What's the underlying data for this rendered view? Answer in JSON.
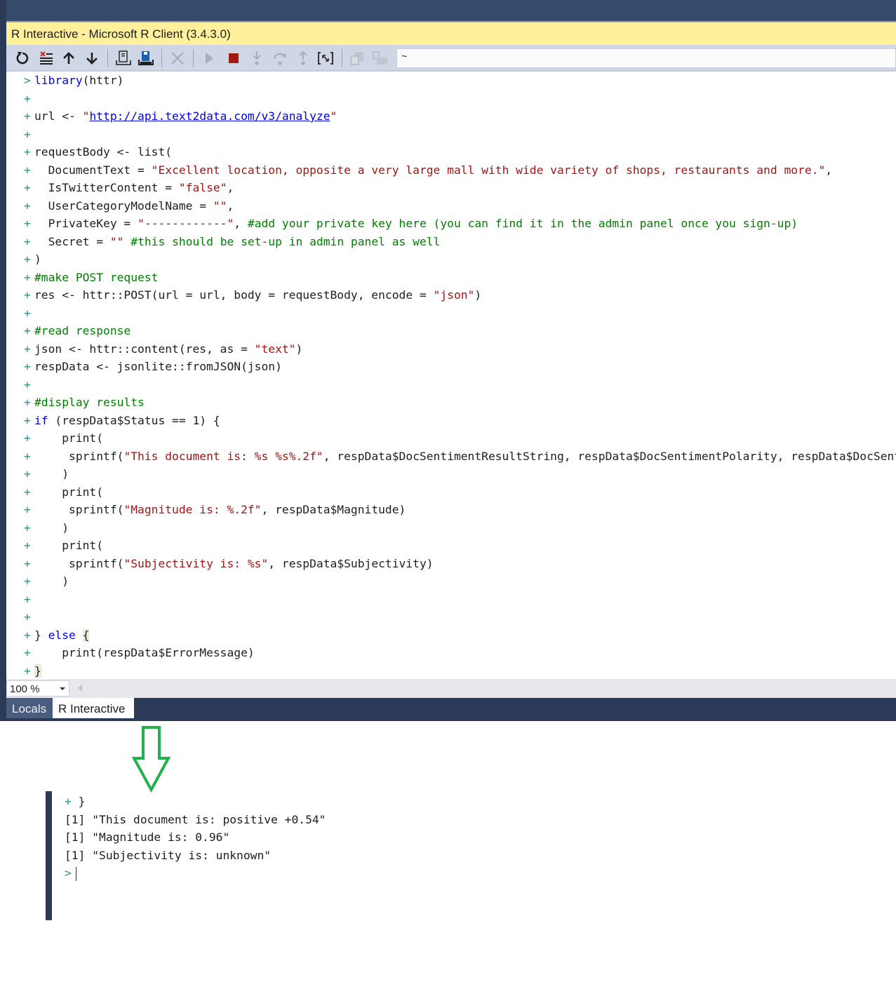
{
  "window": {
    "title": "R Interactive - Microsoft R Client (3.4.3.0)"
  },
  "toolbar": {
    "buttons": [
      {
        "name": "reset-icon",
        "label": "Reset R session"
      },
      {
        "name": "clear-icon",
        "label": "Clear output"
      },
      {
        "name": "history-up-icon",
        "label": "Previous history"
      },
      {
        "name": "history-down-icon",
        "label": "Next history"
      },
      {
        "name": "load-workspace-icon",
        "label": "Load workspace"
      },
      {
        "name": "save-workspace-icon",
        "label": "Save workspace"
      },
      {
        "name": "interrupt-icon",
        "label": "Interrupt"
      },
      {
        "name": "continue-icon",
        "label": "Continue"
      },
      {
        "name": "stop-icon",
        "label": "Stop debugging"
      },
      {
        "name": "step-into-icon",
        "label": "Step into"
      },
      {
        "name": "step-over-icon",
        "label": "Step over"
      },
      {
        "name": "step-out-icon",
        "label": "Step out"
      },
      {
        "name": "attach-debugger-icon",
        "label": "Attach debugger"
      },
      {
        "name": "copy-icon",
        "label": "Copy"
      },
      {
        "name": "paste-icon",
        "label": "Paste"
      }
    ],
    "working_directory": "~",
    "colors": {
      "stop": "#a1190f",
      "save_accent": "#1f5fb0"
    }
  },
  "editor": {
    "lines": [
      {
        "prompt": ">",
        "indent": "",
        "tokens": [
          {
            "t": "kw",
            "v": "library"
          },
          {
            "t": "",
            "v": "(httr)"
          }
        ]
      },
      {
        "prompt": "+",
        "indent": "",
        "tokens": []
      },
      {
        "prompt": "+",
        "indent": "",
        "tokens": [
          {
            "t": "",
            "v": "url <- "
          },
          {
            "t": "str",
            "v": "\""
          },
          {
            "t": "lnk",
            "v": "http://api.text2data.com/v3/analyze"
          },
          {
            "t": "str",
            "v": "\""
          }
        ]
      },
      {
        "prompt": "+",
        "indent": "",
        "tokens": []
      },
      {
        "prompt": "+",
        "indent": "",
        "tokens": [
          {
            "t": "",
            "v": "requestBody <- list("
          }
        ]
      },
      {
        "prompt": "+",
        "indent": "  ",
        "tokens": [
          {
            "t": "",
            "v": "DocumentText = "
          },
          {
            "t": "str",
            "v": "\"Excellent location, opposite a very large mall with wide variety of shops, restaurants and more.\""
          },
          {
            "t": "",
            "v": ","
          }
        ]
      },
      {
        "prompt": "+",
        "indent": "  ",
        "tokens": [
          {
            "t": "",
            "v": "IsTwitterContent = "
          },
          {
            "t": "str",
            "v": "\"false\""
          },
          {
            "t": "",
            "v": ","
          }
        ]
      },
      {
        "prompt": "+",
        "indent": "  ",
        "tokens": [
          {
            "t": "",
            "v": "UserCategoryModelName = "
          },
          {
            "t": "str",
            "v": "\"\""
          },
          {
            "t": "",
            "v": ","
          }
        ]
      },
      {
        "prompt": "+",
        "indent": "  ",
        "tokens": [
          {
            "t": "",
            "v": "PrivateKey = "
          },
          {
            "t": "str",
            "v": "\"------------\""
          },
          {
            "t": "",
            "v": ", "
          },
          {
            "t": "cm",
            "v": "#add your private key here (you can find it in the admin panel once you sign-up)"
          }
        ]
      },
      {
        "prompt": "+",
        "indent": "  ",
        "tokens": [
          {
            "t": "",
            "v": "Secret = "
          },
          {
            "t": "str",
            "v": "\"\""
          },
          {
            "t": "",
            "v": " "
          },
          {
            "t": "cm",
            "v": "#this should be set-up in admin panel as well"
          }
        ]
      },
      {
        "prompt": "+",
        "indent": "",
        "tokens": [
          {
            "t": "",
            "v": ")"
          }
        ]
      },
      {
        "prompt": "+",
        "indent": "",
        "tokens": [
          {
            "t": "cm",
            "v": "#make POST request"
          }
        ]
      },
      {
        "prompt": "+",
        "indent": "",
        "tokens": [
          {
            "t": "",
            "v": "res <- httr::POST(url = url, body = requestBody, encode = "
          },
          {
            "t": "str",
            "v": "\"json\""
          },
          {
            "t": "",
            "v": ")"
          }
        ]
      },
      {
        "prompt": "+",
        "indent": "",
        "tokens": []
      },
      {
        "prompt": "+",
        "indent": "",
        "tokens": [
          {
            "t": "cm",
            "v": "#read response"
          }
        ]
      },
      {
        "prompt": "+",
        "indent": "",
        "tokens": [
          {
            "t": "",
            "v": "json <- httr::content(res, as = "
          },
          {
            "t": "str",
            "v": "\"text\""
          },
          {
            "t": "",
            "v": ")"
          }
        ]
      },
      {
        "prompt": "+",
        "indent": "",
        "tokens": [
          {
            "t": "",
            "v": "respData <- jsonlite::fromJSON(json)"
          }
        ]
      },
      {
        "prompt": "+",
        "indent": "",
        "tokens": []
      },
      {
        "prompt": "+",
        "indent": "",
        "tokens": [
          {
            "t": "cm",
            "v": "#display results"
          }
        ]
      },
      {
        "prompt": "+",
        "indent": "",
        "tokens": [
          {
            "t": "kw",
            "v": "if"
          },
          {
            "t": "",
            "v": " (respData$Status == 1) {"
          }
        ]
      },
      {
        "prompt": "+",
        "indent": "    ",
        "tokens": [
          {
            "t": "",
            "v": "print("
          }
        ]
      },
      {
        "prompt": "+",
        "indent": "     ",
        "tokens": [
          {
            "t": "",
            "v": "sprintf("
          },
          {
            "t": "str",
            "v": "\"This document is: %s %s%.2f\""
          },
          {
            "t": "",
            "v": ", respData$DocSentimentResultString, respData$DocSentimentPolarity, respData$DocSentimentValue)"
          }
        ]
      },
      {
        "prompt": "+",
        "indent": "    ",
        "tokens": [
          {
            "t": "",
            "v": ")"
          }
        ]
      },
      {
        "prompt": "+",
        "indent": "    ",
        "tokens": [
          {
            "t": "",
            "v": "print("
          }
        ]
      },
      {
        "prompt": "+",
        "indent": "     ",
        "tokens": [
          {
            "t": "",
            "v": "sprintf("
          },
          {
            "t": "str",
            "v": "\"Magnitude is: %.2f\""
          },
          {
            "t": "",
            "v": ", respData$Magnitude)"
          }
        ]
      },
      {
        "prompt": "+",
        "indent": "    ",
        "tokens": [
          {
            "t": "",
            "v": ")"
          }
        ]
      },
      {
        "prompt": "+",
        "indent": "    ",
        "tokens": [
          {
            "t": "",
            "v": "print("
          }
        ]
      },
      {
        "prompt": "+",
        "indent": "     ",
        "tokens": [
          {
            "t": "",
            "v": "sprintf("
          },
          {
            "t": "str",
            "v": "\"Subjectivity is: %s\""
          },
          {
            "t": "",
            "v": ", respData$Subjectivity)"
          }
        ]
      },
      {
        "prompt": "+",
        "indent": "    ",
        "tokens": [
          {
            "t": "",
            "v": ")"
          }
        ]
      },
      {
        "prompt": "+",
        "indent": "",
        "tokens": []
      },
      {
        "prompt": "+",
        "indent": "",
        "tokens": []
      },
      {
        "prompt": "+",
        "indent": "",
        "tokens": [
          {
            "t": "",
            "v": "} "
          },
          {
            "t": "kw",
            "v": "else"
          },
          {
            "t": "",
            "v": " "
          },
          {
            "t": "hl",
            "v": "{"
          }
        ]
      },
      {
        "prompt": "+",
        "indent": "    ",
        "tokens": [
          {
            "t": "",
            "v": "print(respData$ErrorMessage)"
          }
        ]
      },
      {
        "prompt": "+",
        "indent": "",
        "tokens": [
          {
            "t": "hl",
            "v": "}"
          }
        ]
      }
    ]
  },
  "status": {
    "zoom_level": "100 %"
  },
  "tabs": [
    {
      "label": "Locals",
      "active": false
    },
    {
      "label": "R Interactive",
      "active": true
    }
  ],
  "annotation": {
    "arrow_icon": "down-arrow-icon",
    "arrow_color": "#22b14c"
  },
  "output": {
    "lines": [
      {
        "prompt": "+",
        "text": " }"
      },
      {
        "prompt": "",
        "text": "[1] \"This document is: positive +0.54\""
      },
      {
        "prompt": "",
        "text": "[1] \"Magnitude is: 0.96\""
      },
      {
        "prompt": "",
        "text": "[1] \"Subjectivity is: unknown\""
      },
      {
        "prompt": ">",
        "text": ""
      }
    ]
  }
}
